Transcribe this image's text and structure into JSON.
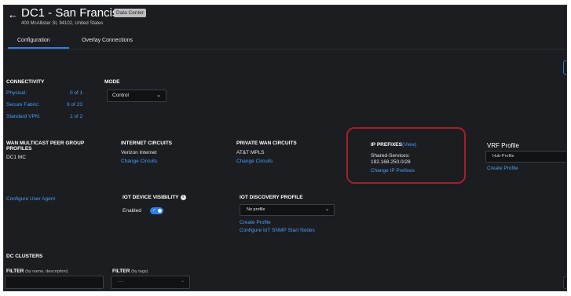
{
  "header": {
    "back_icon": "arrow-left-icon",
    "title": "DC1 - San Francisco",
    "badge": "Data Center",
    "address": "400 McAllister St, 94102, United States"
  },
  "tabs": [
    {
      "label": "Configuration",
      "active": true
    },
    {
      "label": "Overlay Connections",
      "active": false
    }
  ],
  "connectivity": {
    "heading": "CONNECTIVITY",
    "rows": [
      {
        "label": "Physical:",
        "value": "0 of 1"
      },
      {
        "label": "Secure Fabric:",
        "value": "9 of 23"
      },
      {
        "label": "Standard VPN:",
        "value": "1 of 2"
      }
    ]
  },
  "mode": {
    "heading": "MODE",
    "value": "Control"
  },
  "wan_multicast": {
    "heading_line1": "WAN MULTICAST PEER GROUP",
    "heading_line2": "PROFILES",
    "value": "DC1 MC"
  },
  "internet_circuits": {
    "heading": "INTERNET CIRCUITS",
    "value": "Verizon Internet",
    "action": "Change Circuits"
  },
  "private_wan_circuits": {
    "heading": "PRIVATE WAN CIRCUITS",
    "value": "AT&T MPLS",
    "action": "Change Circuits"
  },
  "ip_prefixes": {
    "heading": "IP PREFIXES",
    "view_link": "View",
    "label": "Shared-Services:",
    "value": "192.168.250.0/28",
    "action": "Change IP Prefixes",
    "highlight_color": "#a71d2a"
  },
  "vrf_profile": {
    "heading": "VRF Profile",
    "value": "Hub-Profile",
    "action": "Create Profile"
  },
  "user_agent": {
    "action": "Configure User Agent"
  },
  "iot_visibility": {
    "heading": "IOT DEVICE VISIBILITY",
    "info_icon": "info-icon",
    "status": "Enabled",
    "toggle_on": true
  },
  "iot_discovery": {
    "heading": "IOT DISCOVERY PROFILE",
    "value": "No profile",
    "action1": "Create Profile",
    "action2": "Configure IoT SNMP Start Nodes"
  },
  "dc_clusters": {
    "heading": "DC CLUSTERS",
    "filter_label": "FILTER",
    "filter_sub": "(by name, description)",
    "tags_label": "FILTER",
    "tags_sub": "(by tags)",
    "tags_placeholder": "----"
  },
  "colors": {
    "background": "#1b1d21",
    "accent": "#2f7fe0",
    "link": "#4a9ff5"
  }
}
